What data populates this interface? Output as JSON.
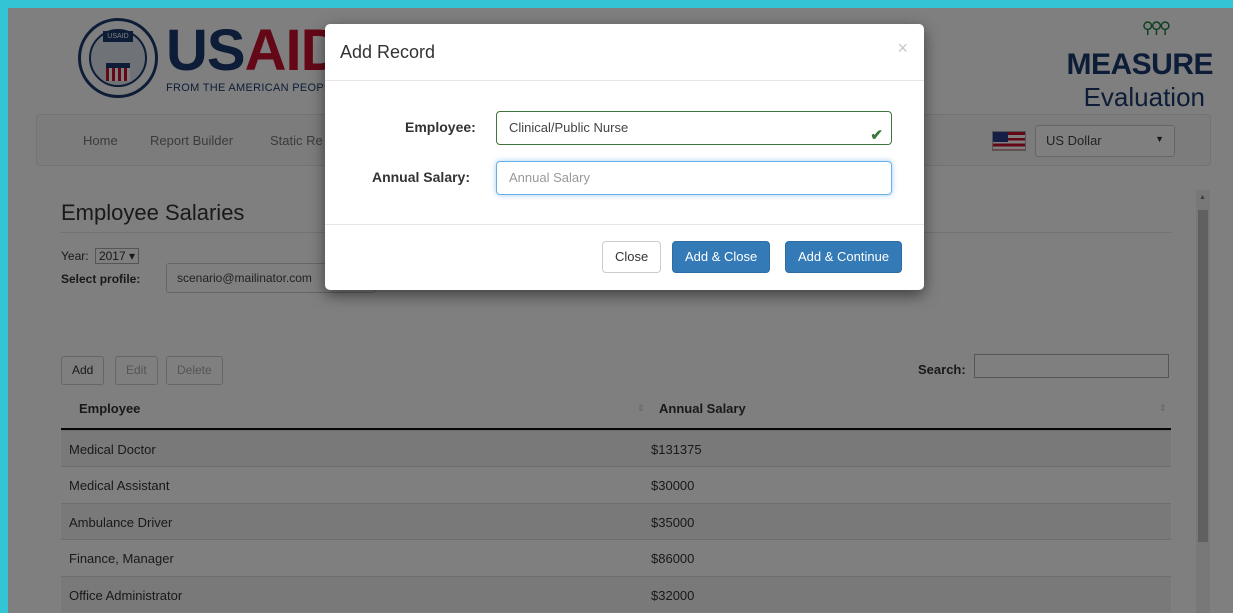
{
  "header": {
    "usaid_tag": "USAID",
    "usaid_us": "US",
    "usaid_aid": "AID",
    "usaid_sub": "FROM THE AMERICAN PEOPLE",
    "measure_word": "MEASURE",
    "eval_word": "Evaluation"
  },
  "nav": {
    "items": [
      "Home",
      "Report Builder",
      "Static Re"
    ],
    "currency": "US Dollar"
  },
  "page": {
    "title": "Employee Salaries",
    "year_label": "Year:",
    "year_value": "2017 ▾",
    "profile_label": "Select profile:",
    "profile_value": "scenario@mailinator.com"
  },
  "toolbar": {
    "add": "Add",
    "edit": "Edit",
    "delete": "Delete",
    "search_label": "Search:"
  },
  "table": {
    "columns": [
      "Employee",
      "Annual Salary"
    ],
    "rows": [
      {
        "employee": "Medical Doctor",
        "salary": "$131375"
      },
      {
        "employee": "Medical Assistant",
        "salary": "$30000"
      },
      {
        "employee": "Ambulance Driver",
        "salary": "$35000"
      },
      {
        "employee": "Finance, Manager",
        "salary": "$86000"
      },
      {
        "employee": "Office Administrator",
        "salary": "$32000"
      }
    ]
  },
  "modal": {
    "title": "Add Record",
    "close_glyph": "×",
    "employee_label": "Employee:",
    "employee_value": "Clinical/Public Nurse",
    "salary_label": "Annual Salary:",
    "salary_placeholder": "Annual Salary",
    "close_btn": "Close",
    "add_close_btn": "Add & Close",
    "add_continue_btn": "Add & Continue"
  },
  "colors": {
    "primary": "#337ab7",
    "frame": "#33c4d6",
    "usaid_blue": "#1b3a6e",
    "usaid_red": "#c8102e",
    "valid_green": "#3c763d"
  },
  "icons": [
    "usaid-seal-icon",
    "people-icon",
    "us-flag-icon",
    "caret-down-icon",
    "sort-icon",
    "close-icon",
    "check-icon"
  ]
}
